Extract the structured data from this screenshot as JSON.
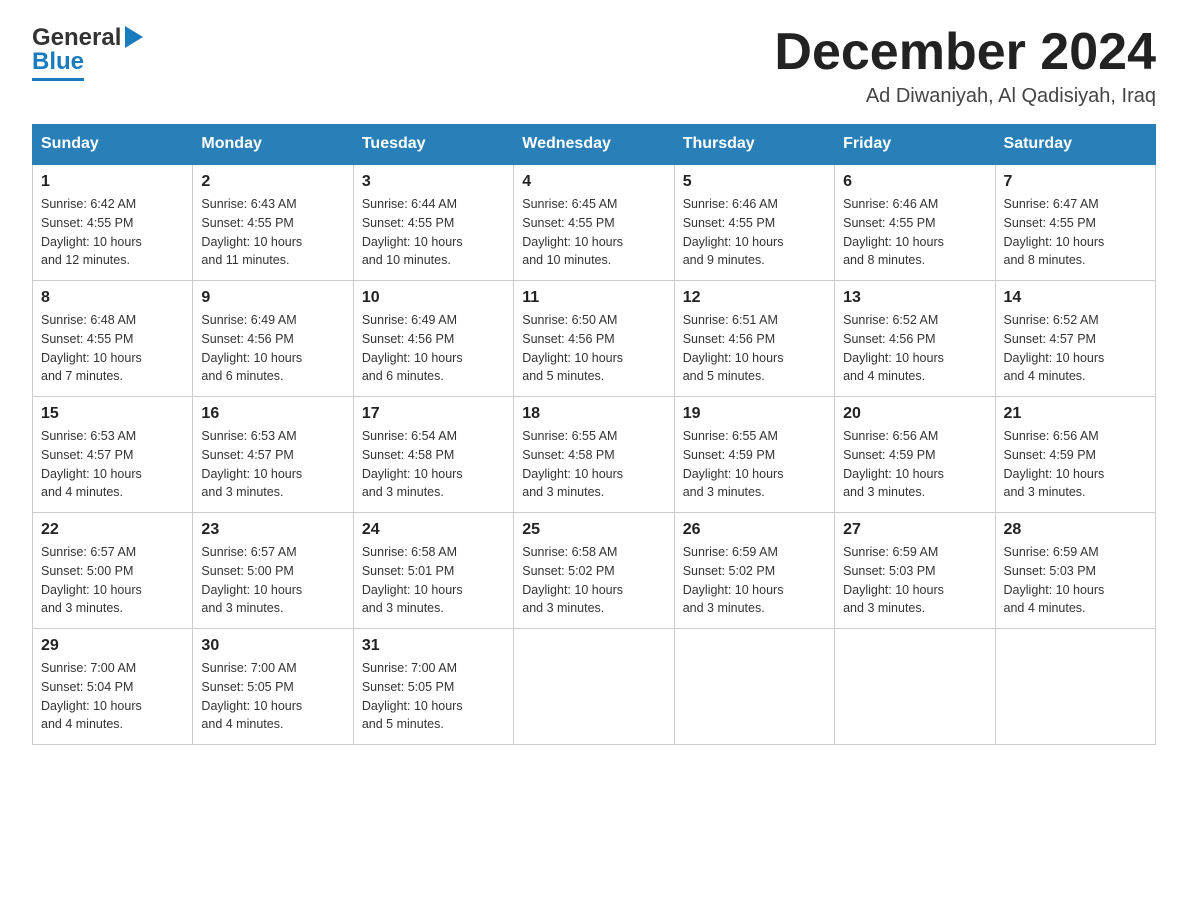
{
  "header": {
    "logo_general": "General",
    "logo_blue": "Blue",
    "month_title": "December 2024",
    "location": "Ad Diwaniyah, Al Qadisiyah, Iraq"
  },
  "days_of_week": [
    "Sunday",
    "Monday",
    "Tuesday",
    "Wednesday",
    "Thursday",
    "Friday",
    "Saturday"
  ],
  "weeks": [
    [
      {
        "day": "1",
        "sunrise": "6:42 AM",
        "sunset": "4:55 PM",
        "daylight": "10 hours and 12 minutes."
      },
      {
        "day": "2",
        "sunrise": "6:43 AM",
        "sunset": "4:55 PM",
        "daylight": "10 hours and 11 minutes."
      },
      {
        "day": "3",
        "sunrise": "6:44 AM",
        "sunset": "4:55 PM",
        "daylight": "10 hours and 10 minutes."
      },
      {
        "day": "4",
        "sunrise": "6:45 AM",
        "sunset": "4:55 PM",
        "daylight": "10 hours and 10 minutes."
      },
      {
        "day": "5",
        "sunrise": "6:46 AM",
        "sunset": "4:55 PM",
        "daylight": "10 hours and 9 minutes."
      },
      {
        "day": "6",
        "sunrise": "6:46 AM",
        "sunset": "4:55 PM",
        "daylight": "10 hours and 8 minutes."
      },
      {
        "day": "7",
        "sunrise": "6:47 AM",
        "sunset": "4:55 PM",
        "daylight": "10 hours and 8 minutes."
      }
    ],
    [
      {
        "day": "8",
        "sunrise": "6:48 AM",
        "sunset": "4:55 PM",
        "daylight": "10 hours and 7 minutes."
      },
      {
        "day": "9",
        "sunrise": "6:49 AM",
        "sunset": "4:56 PM",
        "daylight": "10 hours and 6 minutes."
      },
      {
        "day": "10",
        "sunrise": "6:49 AM",
        "sunset": "4:56 PM",
        "daylight": "10 hours and 6 minutes."
      },
      {
        "day": "11",
        "sunrise": "6:50 AM",
        "sunset": "4:56 PM",
        "daylight": "10 hours and 5 minutes."
      },
      {
        "day": "12",
        "sunrise": "6:51 AM",
        "sunset": "4:56 PM",
        "daylight": "10 hours and 5 minutes."
      },
      {
        "day": "13",
        "sunrise": "6:52 AM",
        "sunset": "4:56 PM",
        "daylight": "10 hours and 4 minutes."
      },
      {
        "day": "14",
        "sunrise": "6:52 AM",
        "sunset": "4:57 PM",
        "daylight": "10 hours and 4 minutes."
      }
    ],
    [
      {
        "day": "15",
        "sunrise": "6:53 AM",
        "sunset": "4:57 PM",
        "daylight": "10 hours and 4 minutes."
      },
      {
        "day": "16",
        "sunrise": "6:53 AM",
        "sunset": "4:57 PM",
        "daylight": "10 hours and 3 minutes."
      },
      {
        "day": "17",
        "sunrise": "6:54 AM",
        "sunset": "4:58 PM",
        "daylight": "10 hours and 3 minutes."
      },
      {
        "day": "18",
        "sunrise": "6:55 AM",
        "sunset": "4:58 PM",
        "daylight": "10 hours and 3 minutes."
      },
      {
        "day": "19",
        "sunrise": "6:55 AM",
        "sunset": "4:59 PM",
        "daylight": "10 hours and 3 minutes."
      },
      {
        "day": "20",
        "sunrise": "6:56 AM",
        "sunset": "4:59 PM",
        "daylight": "10 hours and 3 minutes."
      },
      {
        "day": "21",
        "sunrise": "6:56 AM",
        "sunset": "4:59 PM",
        "daylight": "10 hours and 3 minutes."
      }
    ],
    [
      {
        "day": "22",
        "sunrise": "6:57 AM",
        "sunset": "5:00 PM",
        "daylight": "10 hours and 3 minutes."
      },
      {
        "day": "23",
        "sunrise": "6:57 AM",
        "sunset": "5:00 PM",
        "daylight": "10 hours and 3 minutes."
      },
      {
        "day": "24",
        "sunrise": "6:58 AM",
        "sunset": "5:01 PM",
        "daylight": "10 hours and 3 minutes."
      },
      {
        "day": "25",
        "sunrise": "6:58 AM",
        "sunset": "5:02 PM",
        "daylight": "10 hours and 3 minutes."
      },
      {
        "day": "26",
        "sunrise": "6:59 AM",
        "sunset": "5:02 PM",
        "daylight": "10 hours and 3 minutes."
      },
      {
        "day": "27",
        "sunrise": "6:59 AM",
        "sunset": "5:03 PM",
        "daylight": "10 hours and 3 minutes."
      },
      {
        "day": "28",
        "sunrise": "6:59 AM",
        "sunset": "5:03 PM",
        "daylight": "10 hours and 4 minutes."
      }
    ],
    [
      {
        "day": "29",
        "sunrise": "7:00 AM",
        "sunset": "5:04 PM",
        "daylight": "10 hours and 4 minutes."
      },
      {
        "day": "30",
        "sunrise": "7:00 AM",
        "sunset": "5:05 PM",
        "daylight": "10 hours and 4 minutes."
      },
      {
        "day": "31",
        "sunrise": "7:00 AM",
        "sunset": "5:05 PM",
        "daylight": "10 hours and 5 minutes."
      },
      null,
      null,
      null,
      null
    ]
  ],
  "labels": {
    "sunrise": "Sunrise:",
    "sunset": "Sunset:",
    "daylight": "Daylight:"
  }
}
